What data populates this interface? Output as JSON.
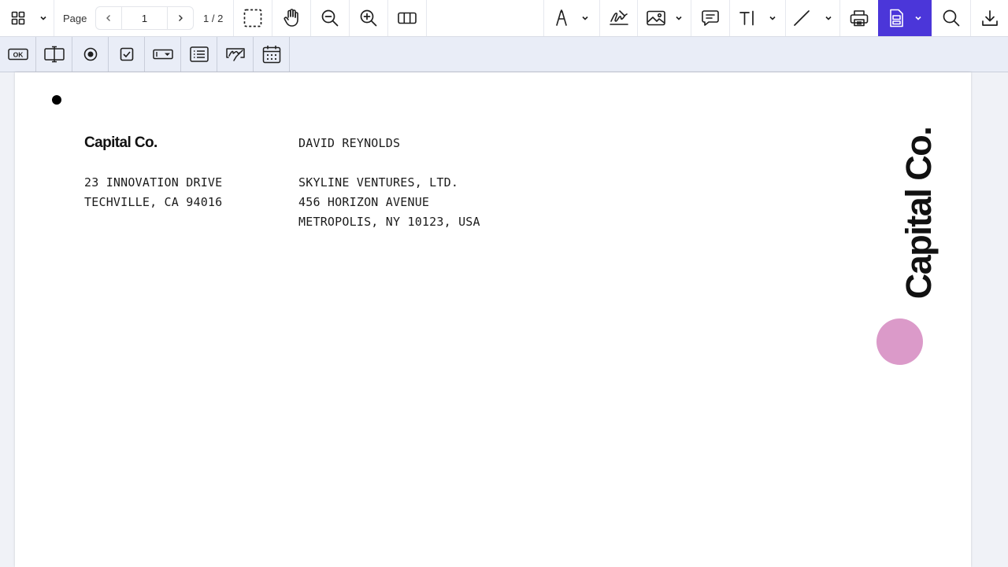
{
  "toolbar": {
    "page_label": "Page",
    "page_value": "1",
    "page_count": "1 / 2",
    "left_icons": [
      "grid-view-icon",
      "chevron-down-icon",
      "chevron-left-icon",
      "chevron-right-icon",
      "marquee-select-icon",
      "hand-pan-icon",
      "zoom-out-icon",
      "zoom-in-icon",
      "two-page-view-icon"
    ],
    "right_icons": [
      "pen-draw-icon",
      "signature-icon",
      "image-icon",
      "comment-icon",
      "text-tool-icon",
      "line-tool-icon",
      "print-icon",
      "form-edit-icon",
      "search-icon",
      "download-icon"
    ],
    "active_color": "#4b36d9"
  },
  "formbar": {
    "tools": [
      "button-field-icon",
      "text-field-icon",
      "radio-button-icon",
      "checkbox-icon",
      "dropdown-field-icon",
      "list-box-icon",
      "signature-field-icon",
      "date-field-icon"
    ],
    "button_field_label": "OK"
  },
  "document": {
    "sender": {
      "company": "Capital Co.",
      "address_line1": "23 INNOVATION DRIVE",
      "address_line2": "TECHVILLE, CA 94016"
    },
    "recipient": {
      "name": "DAVID REYNOLDS",
      "company": "SKYLINE VENTURES, LTD.",
      "address_line1": "456 HORIZON AVENUE",
      "address_line2": "METROPOLIS, NY 10123, USA"
    },
    "vertical_logo": "Capital Co.",
    "accent_color": "#db9ac9"
  }
}
